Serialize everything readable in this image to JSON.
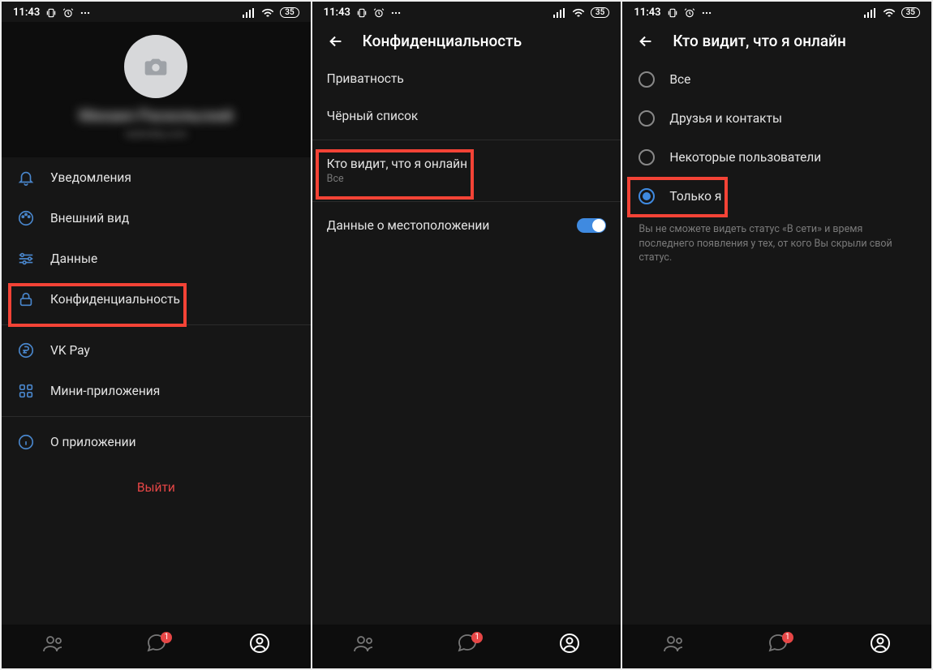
{
  "status": {
    "time": "11:43",
    "battery": "35"
  },
  "screen1": {
    "profile_name_blur": "Михаил Раскольский",
    "profile_sub_blur": "raskolsky.com",
    "menu": {
      "notifications": "Уведомления",
      "appearance": "Внешний вид",
      "data": "Данные",
      "privacy": "Конфиденциальность",
      "vkpay": "VK Pay",
      "miniapps": "Мини-приложения",
      "about": "О приложении"
    },
    "logout": "Выйти",
    "nav_badge": "1"
  },
  "screen2": {
    "title": "Конфиденциальность",
    "items": {
      "privacy": "Приватность",
      "blacklist": "Чёрный список",
      "who_sees_online": "Кто видит, что я онлайн",
      "who_sees_online_sub": "Все",
      "location": "Данные о местоположении"
    },
    "nav_badge": "1"
  },
  "screen3": {
    "title": "Кто видит, что я онлайн",
    "options": {
      "all": "Все",
      "friends": "Друзья и контакты",
      "some": "Некоторые пользователи",
      "only_me": "Только я"
    },
    "hint": "Вы не сможете видеть статус «В сети» и время последнего появления у тех, от кого Вы скрыли свой статус.",
    "nav_badge": "1"
  }
}
